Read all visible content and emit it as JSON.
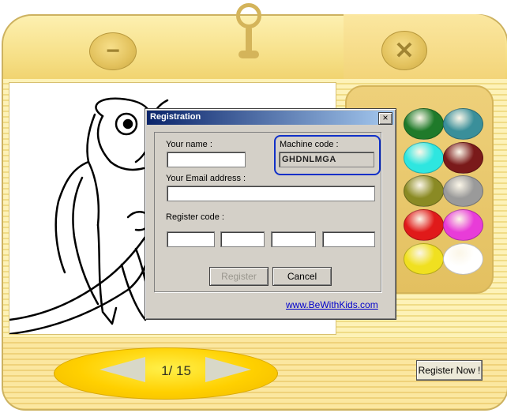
{
  "app": {
    "page_counter": "1/ 15",
    "register_now_label": "Register Now !",
    "minimize_symbol": "−",
    "close_symbol": "✕",
    "palette_colors": [
      "#1f7a2a",
      "#3a8f9a",
      "#2ee6e0",
      "#7a1a1a",
      "#8a8a24",
      "#9a9a9a",
      "#e01a1a",
      "#e83cd8",
      "#f0e020",
      "#ffffff"
    ]
  },
  "dialog": {
    "title": "Registration",
    "close_label": "×",
    "your_name_label": "Your name :",
    "your_name_value": "",
    "machine_code_label": "Machine code :",
    "machine_code_value": "GHDNLMGA",
    "email_label": "Your Email address :",
    "email_value": "",
    "register_code_label": "Register code :",
    "register_code_values": [
      "",
      "",
      "",
      ""
    ],
    "register_button": "Register",
    "cancel_button": "Cancel",
    "website_link": "www.BeWithKids.com"
  }
}
